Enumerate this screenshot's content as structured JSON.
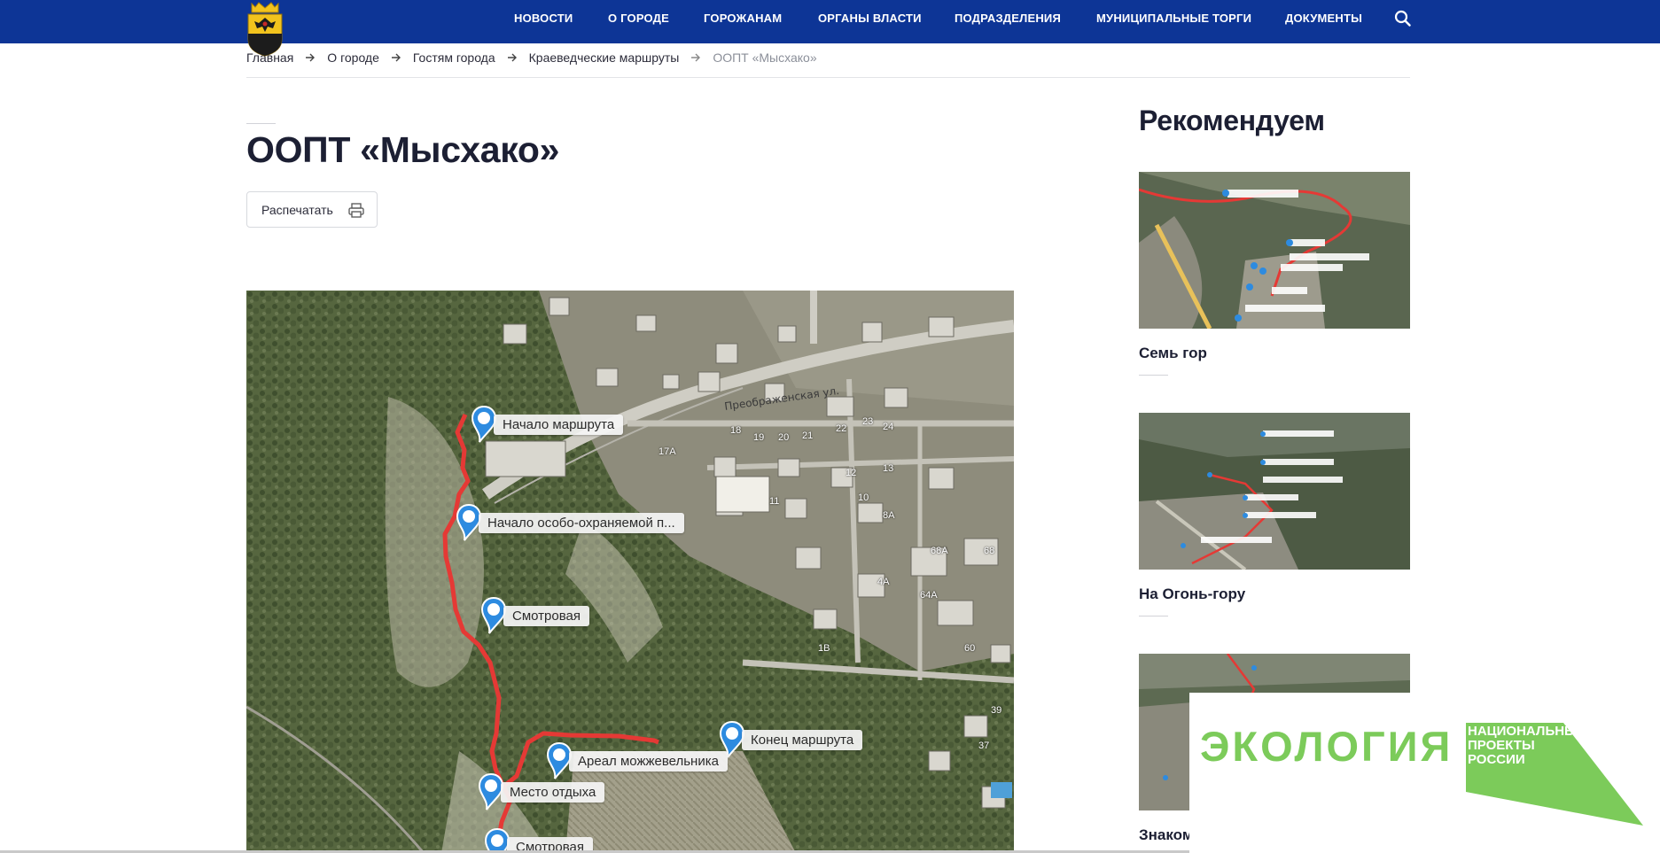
{
  "header": {
    "nav": [
      {
        "label": "НОВОСТИ"
      },
      {
        "label": "О ГОРОДЕ"
      },
      {
        "label": "ГОРОЖАНАМ"
      },
      {
        "label": "ОРГАНЫ ВЛАСТИ"
      },
      {
        "label": "ПОДРАЗДЕЛЕНИЯ"
      },
      {
        "label": "МУНИЦИПАЛЬНЫЕ ТОРГИ"
      },
      {
        "label": "ДОКУМЕНТЫ"
      }
    ],
    "search_icon": "search-icon",
    "logo_icon": "city-coat-of-arms"
  },
  "breadcrumb": {
    "items": [
      "Главная",
      "О городе",
      "Гостям города",
      "Краеведческие маршруты"
    ],
    "current": "ООПТ «Мысхако»"
  },
  "page": {
    "title": "ООПТ «Мысхако»",
    "print_label": "Распечатать",
    "print_icon": "printer-icon"
  },
  "map": {
    "route_color": "#e53935",
    "markers": [
      {
        "label": "Начало маршрута"
      },
      {
        "label": "Начало особо-охраняемой п..."
      },
      {
        "label": "Смотровая"
      },
      {
        "label": "Конец маршрута"
      },
      {
        "label": "Ареал можжевельника"
      },
      {
        "label": "Место отдыха"
      },
      {
        "label": "Смотровая"
      }
    ],
    "street_label": "Преображенская ул.",
    "house_numbers": [
      "19",
      "18",
      "20",
      "21",
      "22",
      "23",
      "24",
      "12",
      "13",
      "10",
      "11",
      "17А",
      "8А",
      "68А",
      "68",
      "4А",
      "64А",
      "1В",
      "60",
      "39",
      "37"
    ]
  },
  "sidebar": {
    "title": "Рекомендуем",
    "cards": [
      {
        "caption": "Семь гор"
      },
      {
        "caption": "На Огонь-гору"
      },
      {
        "caption": "Знаком"
      }
    ]
  },
  "banner": {
    "text": "ЭКОЛОГИЯ",
    "logo_text": "НАЦИОНАЛЬНЫЕ ПРОЕКТЫ РОССИИ",
    "accent": "#7ccb5a",
    "logo_color": "#7ccb5a"
  },
  "colors": {
    "header_bg": "#0d3596",
    "text": "#1c1f33"
  }
}
